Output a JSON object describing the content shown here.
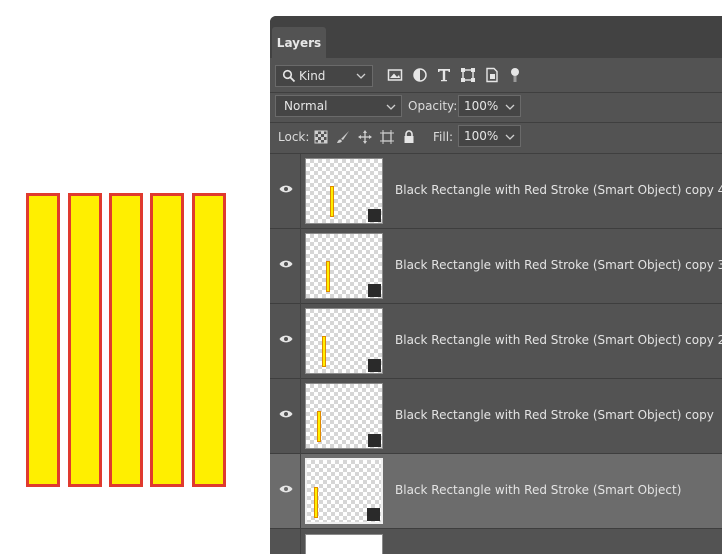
{
  "canvas": {
    "bar_fill": "#ffef00",
    "bar_stroke": "#e03a2e",
    "bar_count": 5
  },
  "panel": {
    "tab_label": "Layers",
    "filter": {
      "kind_label": "Kind",
      "icons": [
        "image-filter-icon",
        "adjustment-filter-icon",
        "type-filter-icon",
        "shape-filter-icon",
        "smart-object-filter-icon",
        "filter-toggle-icon"
      ]
    },
    "blend_mode": "Normal",
    "opacity_label": "Opacity:",
    "opacity_value": "100%",
    "lock_label": "Lock:",
    "lock_icons": [
      "lock-transparent-pixels-icon",
      "lock-image-pixels-icon",
      "lock-position-icon",
      "lock-artboard-icon",
      "lock-all-icon"
    ],
    "fill_label": "Fill:",
    "fill_value": "100%",
    "layers": [
      {
        "name": "Black Rectangle with Red Stroke (Smart Object) copy 4",
        "selected": false
      },
      {
        "name": "Black Rectangle with Red Stroke (Smart Object) copy 3",
        "selected": false
      },
      {
        "name": "Black Rectangle with Red Stroke (Smart Object) copy 2",
        "selected": false
      },
      {
        "name": "Black Rectangle with Red Stroke (Smart Object) copy",
        "selected": false
      },
      {
        "name": "Black Rectangle with Red Stroke (Smart Object)",
        "selected": true
      }
    ]
  }
}
